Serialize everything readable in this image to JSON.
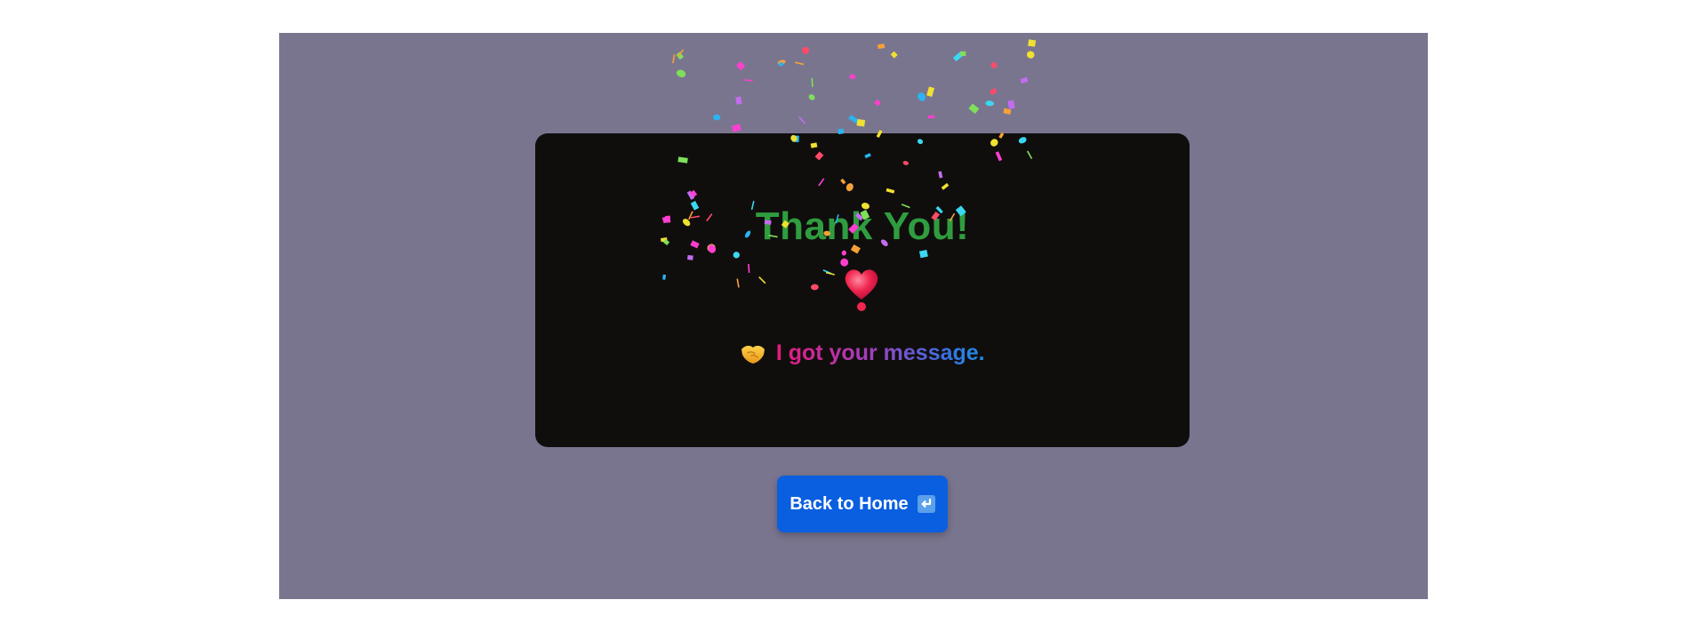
{
  "card": {
    "title": "Thank You!",
    "message": "I got your message.",
    "message_icon": "handshake-icon",
    "decoration_icon": "heart-icon"
  },
  "button": {
    "label": "Back to Home",
    "icon": "return-arrow-icon"
  },
  "colors": {
    "background": "#7a758f",
    "card": "#100e0d",
    "title": "#2f9d3f",
    "button": "#0a5fe0",
    "message_gradient": [
      "#e8197a",
      "#a43fbe",
      "#1c8fe8"
    ],
    "confetti": [
      "#ff3fd0",
      "#2ab4f0",
      "#f6a136",
      "#7ee05a",
      "#c46cf0",
      "#f0e030",
      "#ff4a6a",
      "#3ad8f0"
    ]
  }
}
